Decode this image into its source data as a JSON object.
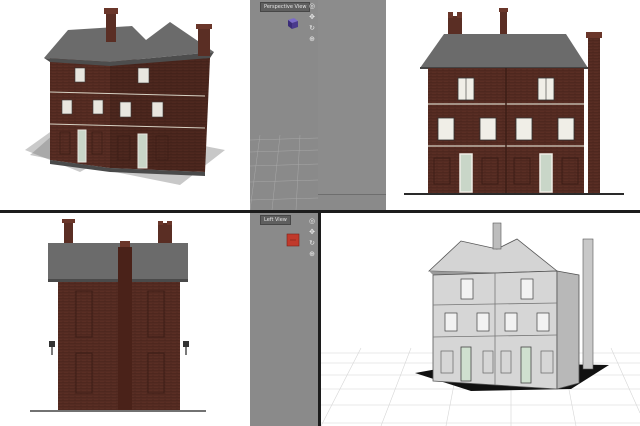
{
  "viewports": {
    "top_left": {
      "name": "perspective-render-view"
    },
    "top_right": {
      "name": "front-render-view"
    },
    "bottom_left": {
      "name": "left-render-view"
    },
    "bottom_right": {
      "name": "wireframe-perspective-view"
    }
  },
  "grey_viewports": {
    "upper": {
      "label": "Perspective View",
      "cube_color": "#4a3a8c"
    },
    "lower": {
      "label": "Left View",
      "cube_color": "#c0392b"
    }
  },
  "side_icons": {
    "upper": [
      "camera-icon",
      "pan-icon",
      "rotate-icon",
      "zoom-icon"
    ],
    "lower": [
      "camera-icon",
      "pan-icon",
      "rotate-icon",
      "zoom-icon"
    ]
  },
  "colors": {
    "brick": "#5a2e24",
    "brick_dark": "#3d1e17",
    "roof": "#6b6b6b",
    "trim": "#d8d2c4",
    "wire_fill": "#cfcfcf",
    "viewport_grey": "#8a8a8a"
  }
}
